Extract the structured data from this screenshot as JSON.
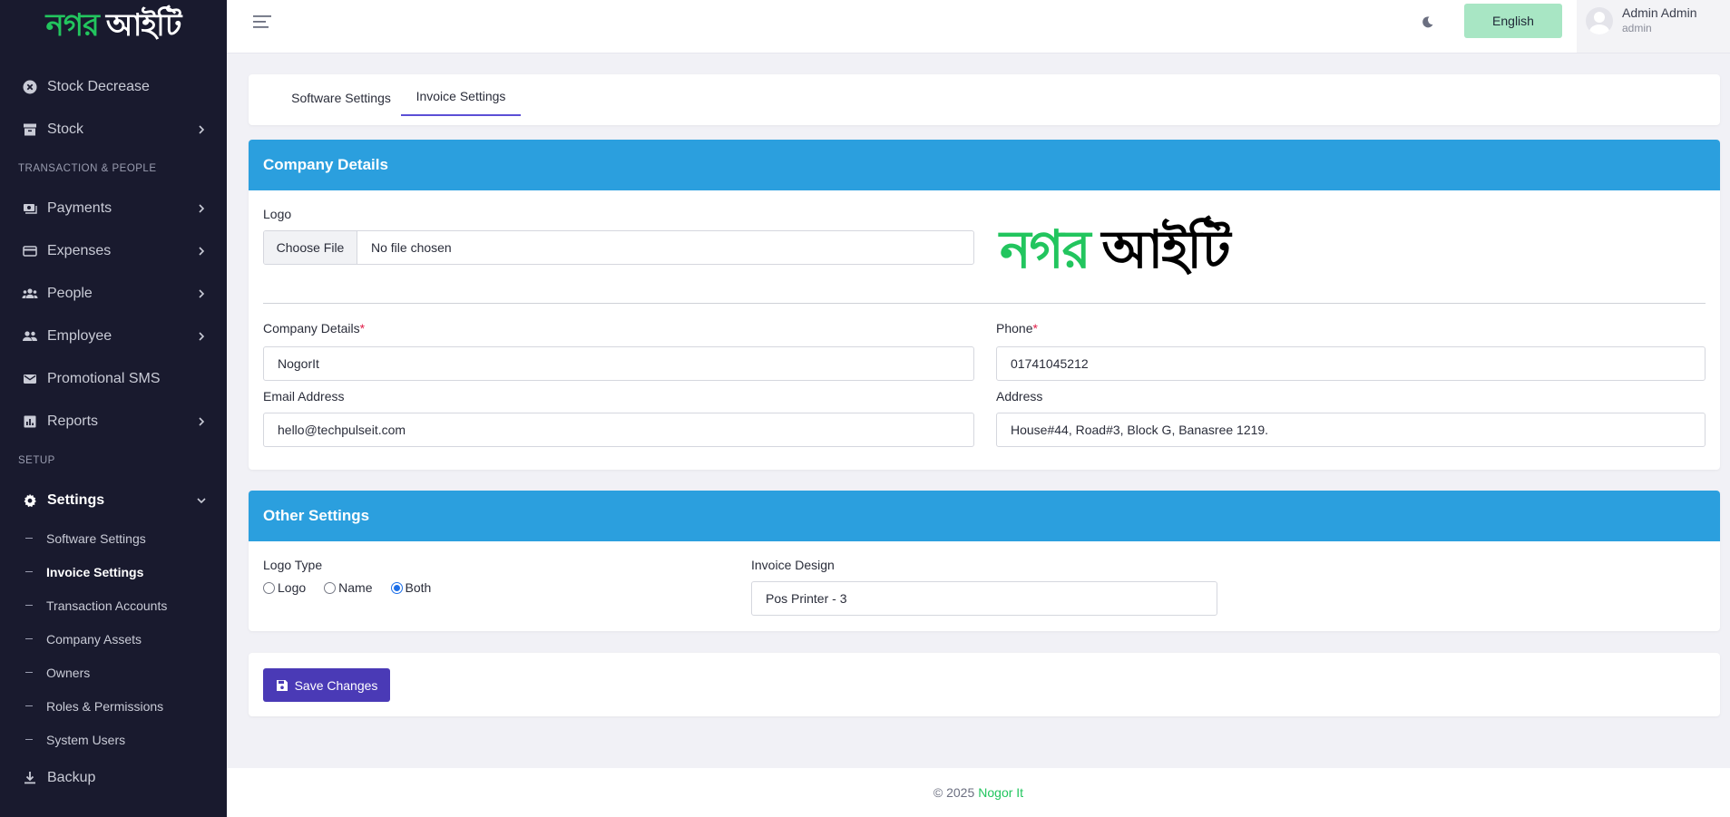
{
  "brand": {
    "logo_green": "নগর",
    "logo_white": "আইটি",
    "accent": "#22c55e"
  },
  "sidebar": {
    "items": [
      {
        "label": "Stock Decrease",
        "icon": "x-circle-icon"
      },
      {
        "label": "Stock",
        "icon": "archive-icon"
      }
    ],
    "section_transaction": "TRANSACTION & PEOPLE",
    "items2": [
      {
        "label": "Payments",
        "icon": "money-icon"
      },
      {
        "label": "Expenses",
        "icon": "card-icon"
      },
      {
        "label": "People",
        "icon": "people-icon"
      },
      {
        "label": "Employee",
        "icon": "employee-icon"
      },
      {
        "label": "Promotional SMS",
        "icon": "mail-icon"
      },
      {
        "label": "Reports",
        "icon": "chart-icon"
      }
    ],
    "section_setup": "SETUP",
    "settings": {
      "label": "Settings",
      "icon": "gear-icon"
    },
    "sub_items": [
      {
        "label": "Software Settings"
      },
      {
        "label": "Invoice Settings"
      },
      {
        "label": "Transaction Accounts"
      },
      {
        "label": "Company Assets"
      },
      {
        "label": "Owners"
      },
      {
        "label": "Roles & Permissions"
      },
      {
        "label": "System Users"
      }
    ],
    "backup": {
      "label": "Backup",
      "icon": "download-icon"
    }
  },
  "topbar": {
    "language": "English",
    "user_name": "Admin Admin",
    "user_role": "admin"
  },
  "tabs": [
    {
      "label": "Software Settings"
    },
    {
      "label": "Invoice Settings"
    }
  ],
  "company": {
    "title": "Company Details",
    "logo_label": "Logo",
    "choose_file": "Choose File",
    "no_file": "No file chosen",
    "details_label": "Company Details",
    "details_value": "NogorIt",
    "phone_label": "Phone",
    "phone_value": "01741045212",
    "email_label": "Email Address",
    "email_value": "hello@techpulseit.com",
    "address_label": "Address",
    "address_value": "House#44, Road#3, Block G, Banasree 1219.",
    "preview_green": "নগর",
    "preview_black": "আইটি",
    "required_mark": "*"
  },
  "other": {
    "title": "Other Settings",
    "logo_type_label": "Logo Type",
    "options": [
      "Logo",
      "Name",
      "Both"
    ],
    "selected": "Both",
    "invoice_design_label": "Invoice Design",
    "invoice_design_value": "Pos Printer - 3"
  },
  "actions": {
    "save": "Save Changes"
  },
  "footer": {
    "copyright": "© 2025",
    "brand": "Nogor It"
  },
  "colors": {
    "sidebar_bg": "#191a2e",
    "header_blue": "#2b9fde",
    "primary": "#4a3ab6",
    "lang_btn": "#a8e6c4"
  }
}
